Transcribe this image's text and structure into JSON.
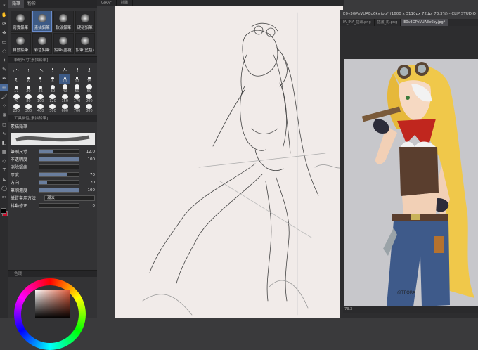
{
  "toolbar": {
    "tools": [
      "search-icon",
      "hand-icon",
      "rotate-icon",
      "move-icon",
      "select-icon",
      "lasso-icon",
      "wand-icon",
      "eyedropper-icon",
      "pen-icon",
      "pencil-icon",
      "brush-icon",
      "airbrush-icon",
      "decoration-icon",
      "eraser-icon",
      "blend-icon",
      "fill-icon",
      "gradient-icon",
      "figure-icon",
      "text-icon",
      "ruler-icon",
      "balloon-icon",
      "correction-icon"
    ]
  },
  "subtool_panel": {
    "tabs": [
      "鉛筆",
      "粉彩"
    ],
    "brushes": [
      {
        "label": "寫實鉛筆"
      },
      {
        "label": "素描鉛筆",
        "selected": true
      },
      {
        "label": "軟碳鉛筆"
      },
      {
        "label": "硬碳鉛筆"
      },
      {
        "label": "自動鉛筆"
      },
      {
        "label": "彩色鉛筆"
      },
      {
        "label": "鉛筆(墨凝)"
      },
      {
        "label": "鉛筆(藍色)"
      }
    ]
  },
  "brush_size_panel": {
    "title": "筆刷尺寸[素描鉛筆]",
    "sizes": [
      "0.7",
      "1",
      "1.5",
      "2",
      "2.5",
      "3",
      "4",
      "5",
      "6",
      "7",
      "8",
      "10",
      "12",
      "15",
      "17",
      "20",
      "25",
      "30",
      "40",
      "50",
      "60",
      "70",
      "80",
      "100",
      "120",
      "150",
      "170",
      "200",
      "250",
      "300",
      "400",
      "500",
      "600",
      "700",
      "800"
    ],
    "selected": "10"
  },
  "tool_property": {
    "title": "工具屬性[素描鉛筆]",
    "name": "素描鉛筆",
    "rows": [
      {
        "label": "筆刷尺寸",
        "value": "12.0",
        "level": 0.35
      },
      {
        "label": "不透明度",
        "value": "100",
        "level": 1.0
      },
      {
        "label": "消除鋸齒",
        "value": "",
        "level": 0
      },
      {
        "label": "厚度",
        "value": "70",
        "level": 0.7
      },
      {
        "label": "方向",
        "value": "20",
        "level": 0.2
      },
      {
        "label": "筆刷濃度",
        "value": "100",
        "level": 1.0
      }
    ],
    "blend_label": "紙質套用方法",
    "blend_value": "減去",
    "stabilization_label": "抖動修正",
    "stabilization_value": "0"
  },
  "color_panel": {
    "title": "色環"
  },
  "document_tabs": [
    "GIRAF",
    "插圖"
  ],
  "reference_window": {
    "title": "E0v3GPeVUAEo6ky.jpg* (1600 x 3110px 72dpi 73.3%) - CLIP STUDIO",
    "tabs": [
      {
        "label": "IA_INA_插頭.png",
        "selected": false
      },
      {
        "label": "插畫_影.png",
        "selected": false
      },
      {
        "label": "E0v3GPeVUAEo6ky.jpg*",
        "selected": true
      }
    ],
    "zoom": "73.3",
    "watermark": "@TFORX"
  },
  "colors": {
    "accent": "#4a6a9a",
    "paper": "#f1ebe9",
    "reference_bg": "#c7c7cb",
    "foreground": "#000000",
    "background_color": "#c8102e"
  }
}
